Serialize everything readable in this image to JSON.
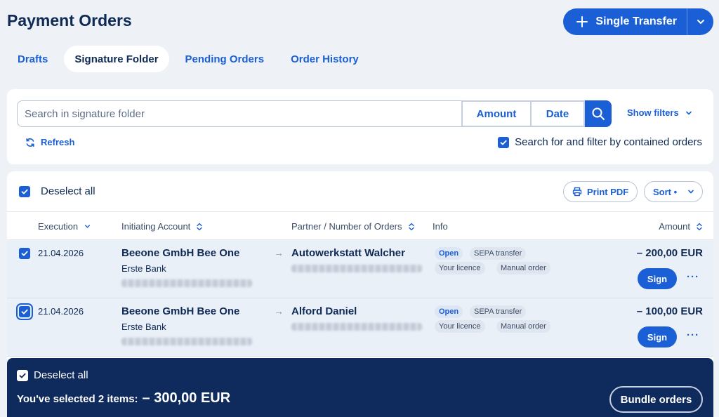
{
  "page": {
    "title": "Payment Orders"
  },
  "header": {
    "transfer_label": "Single Transfer"
  },
  "tabs": [
    {
      "label": "Drafts",
      "active": false
    },
    {
      "label": "Signature Folder",
      "active": true
    },
    {
      "label": "Pending Orders",
      "active": false
    },
    {
      "label": "Order History",
      "active": false
    }
  ],
  "search": {
    "placeholder": "Search in signature folder",
    "value": "",
    "amount_label": "Amount",
    "date_label": "Date",
    "show_filters_label": "Show filters",
    "refresh_label": "Refresh",
    "contained_label": "Search for and filter by contained orders",
    "contained_checked": true
  },
  "list": {
    "deselect_label": "Deselect all",
    "print_pdf_label": "Print PDF",
    "sort_label": "Sort •",
    "columns": {
      "execution": "Execution",
      "account": "Initiating Account",
      "partner": "Partner / Number of Orders",
      "info": "Info",
      "amount": "Amount"
    },
    "rows": [
      {
        "date": "21.04.2026",
        "account": "Beeone GmbH Bee One",
        "bank": "Erste Bank",
        "partner": "Autowerkstatt Walcher",
        "status": "Open",
        "type": "SEPA transfer",
        "licence": "Your licence",
        "order_kind": "Manual order",
        "amount": "– 200,00 EUR",
        "sign_label": "Sign",
        "more_label": "···"
      },
      {
        "date": "21.04.2026",
        "account": "Beeone GmbH Bee One",
        "bank": "Erste Bank",
        "partner": "Alford Daniel",
        "status": "Open",
        "type": "SEPA transfer",
        "licence": "Your licence",
        "order_kind": "Manual order",
        "amount": "– 100,00 EUR",
        "sign_label": "Sign",
        "more_label": "···"
      }
    ]
  },
  "footer": {
    "deselect_label": "Deselect all",
    "selected_label": "You've selected 2 items:",
    "selected_amount": "– 300,00 EUR",
    "bundle_label": "Bundle orders"
  },
  "colors": {
    "primary": "#1a5fd6",
    "navy": "#0f2a5c",
    "background": "#eef1f6",
    "row_selected": "#eaf0f8"
  }
}
